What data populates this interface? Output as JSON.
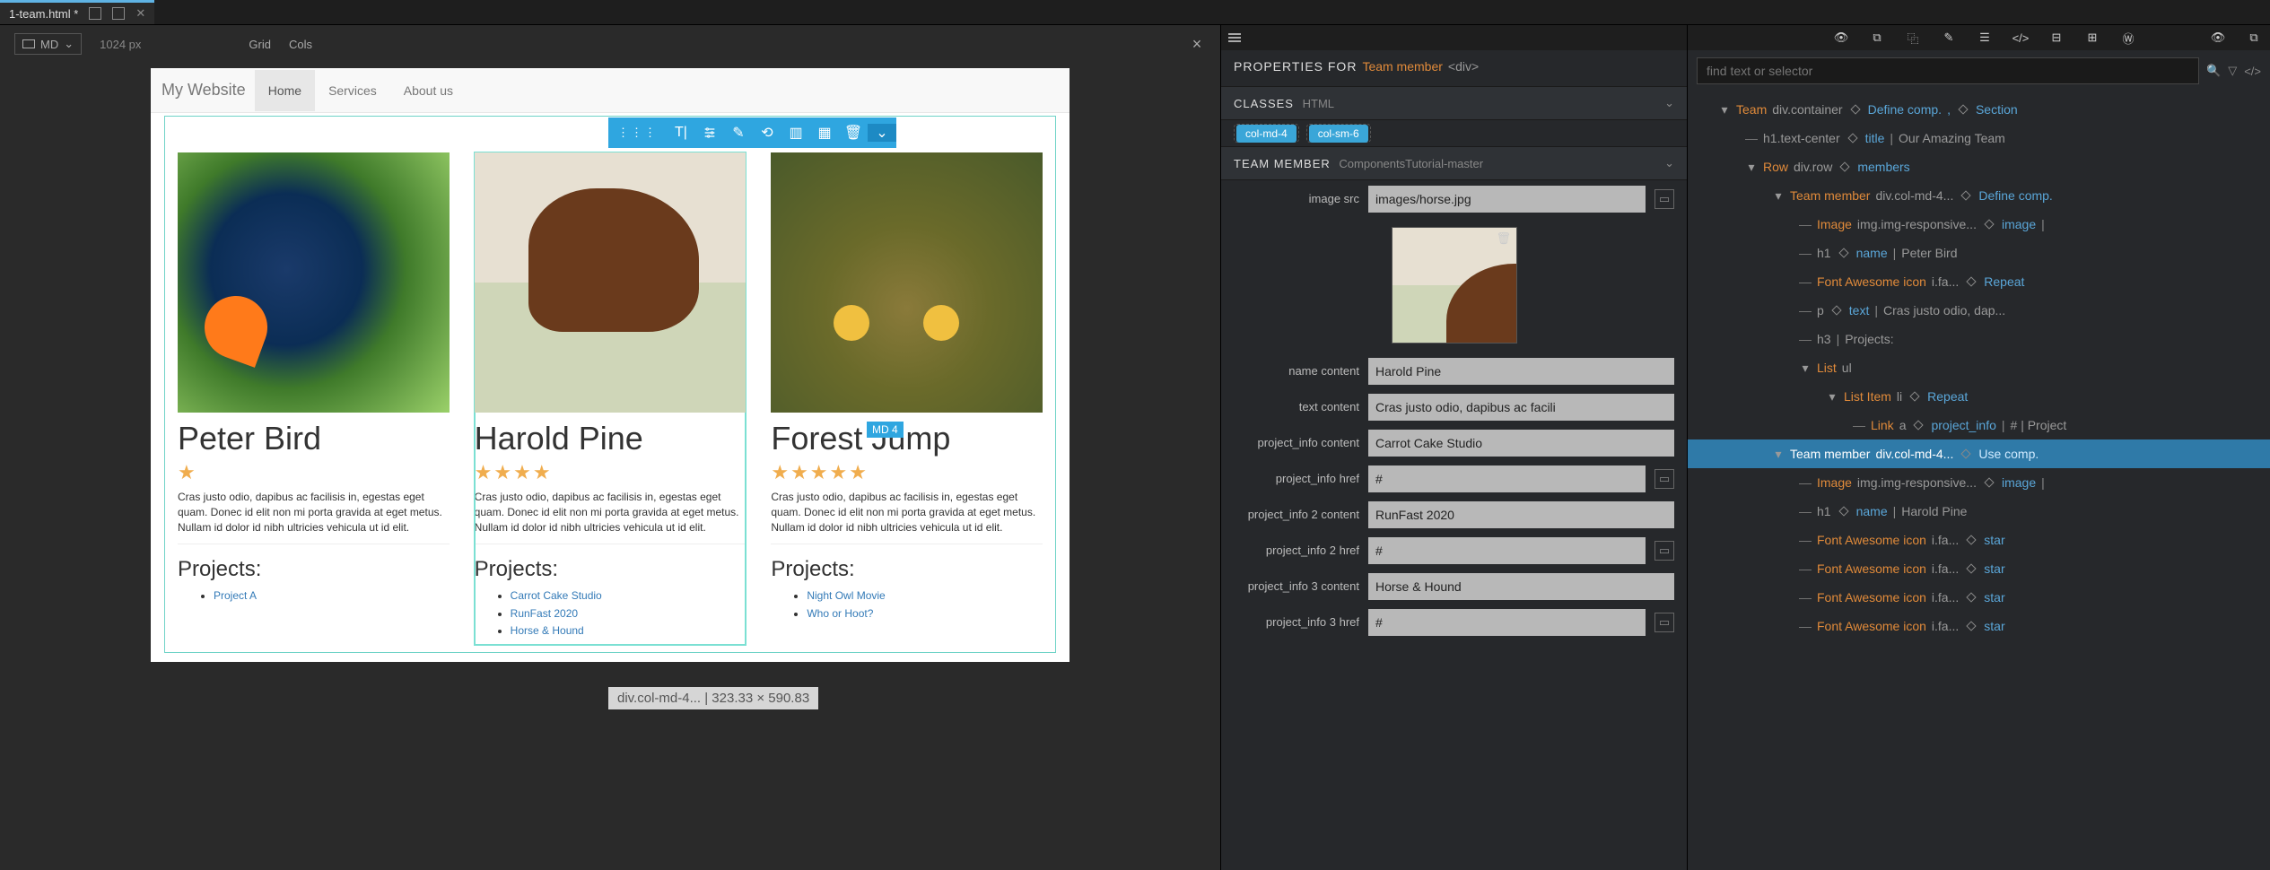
{
  "tab": {
    "filename": "1-team.html *"
  },
  "canvas": {
    "breakpoint": "MD",
    "width_label": "1024 px",
    "grid_label": "Grid",
    "cols_label": "Cols",
    "status": "div.col-md-4... | 323.33 × 590.83",
    "selection_badge": "MD 4"
  },
  "site": {
    "brand": "My Website",
    "nav": [
      "Home",
      "Services",
      "About us"
    ],
    "desc": "Cras justo odio, dapibus ac facilisis in, egestas eget quam. Donec id elit non mi porta gravida at eget metus. Nullam id dolor id nibh ultricies vehicula ut id elit.",
    "projects_h": "Projects:",
    "members": [
      {
        "name": "Peter Bird",
        "stars": 1,
        "projects": [
          "Project A"
        ]
      },
      {
        "name": "Harold Pine",
        "stars": 4,
        "projects": [
          "Carrot Cake Studio",
          "RunFast 2020",
          "Horse & Hound"
        ]
      },
      {
        "name": "Forest Jump",
        "stars": 5,
        "projects": [
          "Night Owl Movie",
          "Who or Hoot?"
        ]
      }
    ]
  },
  "props": {
    "header_lbl": "PROPERTIES FOR",
    "header_name": "Team member",
    "header_type": "<div>",
    "classes_title": "CLASSES",
    "classes_sub": "HTML",
    "pills": [
      "col-md-4",
      "col-sm-6"
    ],
    "comp_title": "TEAM MEMBER",
    "comp_sub": "ComponentsTutorial-master",
    "fields": {
      "image_src_lbl": "image src",
      "image_src": "images/horse.jpg",
      "name_lbl": "name content",
      "name": "Harold Pine",
      "text_lbl": "text content",
      "text": "Cras justo odio, dapibus ac facili",
      "p1c_lbl": "project_info content",
      "p1c": "Carrot Cake Studio",
      "p1h_lbl": "project_info href",
      "p1h": "#",
      "p2c_lbl": "project_info 2 content",
      "p2c": "RunFast 2020",
      "p2h_lbl": "project_info 2 href",
      "p2h": "#",
      "p3c_lbl": "project_info 3 content",
      "p3c": "Horse & Hound",
      "p3h_lbl": "project_info 3 href",
      "p3h": "#"
    }
  },
  "tree": {
    "search_placeholder": "find text or selector",
    "rows": [
      {
        "d": 0,
        "t": "tri",
        "name": "Team",
        "sel": "div.container",
        "links": [
          "Define comp.",
          "Section"
        ]
      },
      {
        "d": 1,
        "t": "dash",
        "name": "",
        "sel": "h1.text-center",
        "links": [
          "title"
        ],
        "after": "Our Amazing Team"
      },
      {
        "d": 1,
        "t": "tri",
        "name": "Row",
        "sel": "div.row",
        "links": [
          "members"
        ]
      },
      {
        "d": 2,
        "t": "tri",
        "name": "Team member",
        "sel": "div.col-md-4...",
        "links": [
          "Define comp."
        ]
      },
      {
        "d": 3,
        "t": "dash",
        "name": "Image",
        "sel": "img.img-responsive...",
        "links": [
          "image"
        ],
        "after": ""
      },
      {
        "d": 3,
        "t": "dash",
        "name": "",
        "sel": "h1",
        "links": [
          "name"
        ],
        "after": "Peter Bird"
      },
      {
        "d": 3,
        "t": "dash",
        "name": "Font Awesome icon",
        "sel": "i.fa...",
        "links": [
          "Repeat"
        ]
      },
      {
        "d": 3,
        "t": "dash",
        "name": "",
        "sel": "p",
        "links": [
          "text"
        ],
        "after": "Cras justo odio, dap..."
      },
      {
        "d": 3,
        "t": "dash",
        "name": "",
        "sel": "h3",
        "after": "Projects:"
      },
      {
        "d": 3,
        "t": "tri",
        "name": "List",
        "sel": "ul"
      },
      {
        "d": 4,
        "t": "tri",
        "name": "List Item",
        "sel": "li",
        "links": [
          "Repeat"
        ]
      },
      {
        "d": 5,
        "t": "dash",
        "name": "Link",
        "sel": "a",
        "links": [
          "project_info"
        ],
        "after": "# | Project"
      },
      {
        "d": 2,
        "t": "tri",
        "name": "Team member",
        "sel": "div.col-md-4...",
        "links": [
          "Use comp."
        ],
        "hl": true
      },
      {
        "d": 3,
        "t": "dash",
        "name": "Image",
        "sel": "img.img-responsive...",
        "links": [
          "image"
        ],
        "after": ""
      },
      {
        "d": 3,
        "t": "dash",
        "name": "",
        "sel": "h1",
        "links": [
          "name"
        ],
        "after": "Harold Pine"
      },
      {
        "d": 3,
        "t": "dash",
        "name": "Font Awesome icon",
        "sel": "i.fa...",
        "links": [
          "star"
        ]
      },
      {
        "d": 3,
        "t": "dash",
        "name": "Font Awesome icon",
        "sel": "i.fa...",
        "links": [
          "star"
        ]
      },
      {
        "d": 3,
        "t": "dash",
        "name": "Font Awesome icon",
        "sel": "i.fa...",
        "links": [
          "star"
        ]
      },
      {
        "d": 3,
        "t": "dash",
        "name": "Font Awesome icon",
        "sel": "i.fa...",
        "links": [
          "star"
        ]
      }
    ]
  }
}
